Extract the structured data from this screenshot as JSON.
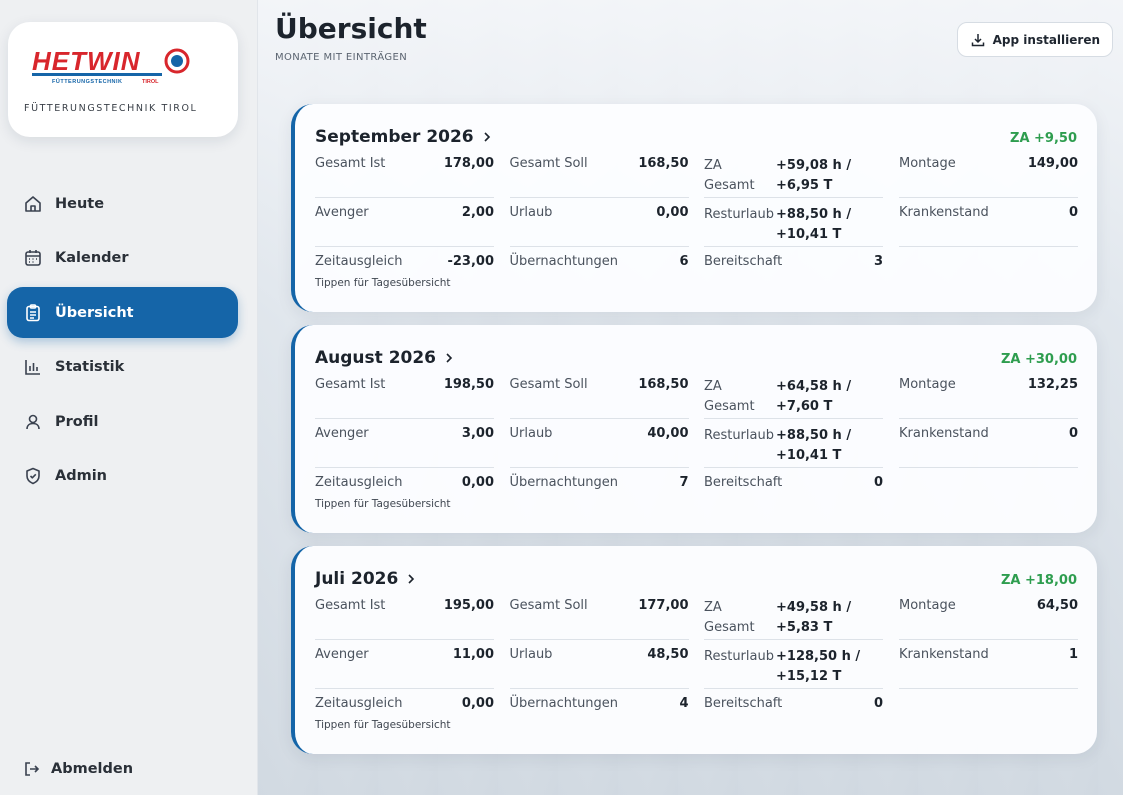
{
  "brand": {
    "logo_text": "HETWIN",
    "logo_small": "FÜTTERUNGSTECHNIK",
    "logo_small_accent": "TIROL",
    "subtitle": "FÜTTERUNGSTECHNIK TIROL"
  },
  "colors": {
    "accent": "#1565a8",
    "brand_red": "#d8262c",
    "positive": "#2e9d4f"
  },
  "nav": {
    "items": [
      {
        "label": "Heute",
        "icon": "home-icon"
      },
      {
        "label": "Kalender",
        "icon": "calendar-icon"
      },
      {
        "label": "Übersicht",
        "icon": "clipboard-icon",
        "active": true
      },
      {
        "label": "Statistik",
        "icon": "bar-chart-icon"
      },
      {
        "label": "Profil",
        "icon": "user-icon"
      },
      {
        "label": "Admin",
        "icon": "shield-check-icon"
      }
    ],
    "logout_label": "Abmelden"
  },
  "header": {
    "title": "Übersicht",
    "subtitle": "MONATE MIT EINTRÄGEN",
    "install_label": "App installieren"
  },
  "months": [
    {
      "title": "September 2026",
      "za": "ZA +9,50",
      "gesamt_ist_label": "Gesamt Ist",
      "gesamt_ist": "178,00",
      "gesamt_soll_label": "Gesamt Soll",
      "gesamt_soll": "168,50",
      "za_gesamt_label": "ZA Gesamt",
      "za_gesamt": "+59,08 h / +6,95 T",
      "montage_label": "Montage",
      "montage": "149,00",
      "avenger_label": "Avenger",
      "avenger": "2,00",
      "urlaub_label": "Urlaub",
      "urlaub": "0,00",
      "resturlaub_label": "Resturlaub",
      "resturlaub": "+88,50 h / +10,41 T",
      "krankenstand_label": "Krankenstand",
      "krankenstand": "0",
      "zeitausgleich_label": "Zeitausgleich",
      "zeitausgleich": "-23,00",
      "uebernachtungen_label": "Übernachtungen",
      "uebernachtungen": "6",
      "bereitschaft_label": "Bereitschaft",
      "bereitschaft": "3",
      "hint": "Tippen für Tagesübersicht"
    },
    {
      "title": "August 2026",
      "za": "ZA +30,00",
      "gesamt_ist_label": "Gesamt Ist",
      "gesamt_ist": "198,50",
      "gesamt_soll_label": "Gesamt Soll",
      "gesamt_soll": "168,50",
      "za_gesamt_label": "ZA Gesamt",
      "za_gesamt": "+64,58 h / +7,60 T",
      "montage_label": "Montage",
      "montage": "132,25",
      "avenger_label": "Avenger",
      "avenger": "3,00",
      "urlaub_label": "Urlaub",
      "urlaub": "40,00",
      "resturlaub_label": "Resturlaub",
      "resturlaub": "+88,50 h / +10,41 T",
      "krankenstand_label": "Krankenstand",
      "krankenstand": "0",
      "zeitausgleich_label": "Zeitausgleich",
      "zeitausgleich": "0,00",
      "uebernachtungen_label": "Übernachtungen",
      "uebernachtungen": "7",
      "bereitschaft_label": "Bereitschaft",
      "bereitschaft": "0",
      "hint": "Tippen für Tagesübersicht"
    },
    {
      "title": "Juli 2026",
      "za": "ZA +18,00",
      "gesamt_ist_label": "Gesamt Ist",
      "gesamt_ist": "195,00",
      "gesamt_soll_label": "Gesamt Soll",
      "gesamt_soll": "177,00",
      "za_gesamt_label": "ZA Gesamt",
      "za_gesamt": "+49,58 h / +5,83 T",
      "montage_label": "Montage",
      "montage": "64,50",
      "avenger_label": "Avenger",
      "avenger": "11,00",
      "urlaub_label": "Urlaub",
      "urlaub": "48,50",
      "resturlaub_label": "Resturlaub",
      "resturlaub": "+128,50 h / +15,12 T",
      "krankenstand_label": "Krankenstand",
      "krankenstand": "1",
      "zeitausgleich_label": "Zeitausgleich",
      "zeitausgleich": "0,00",
      "uebernachtungen_label": "Übernachtungen",
      "uebernachtungen": "4",
      "bereitschaft_label": "Bereitschaft",
      "bereitschaft": "0",
      "hint": "Tippen für Tagesübersicht"
    }
  ]
}
